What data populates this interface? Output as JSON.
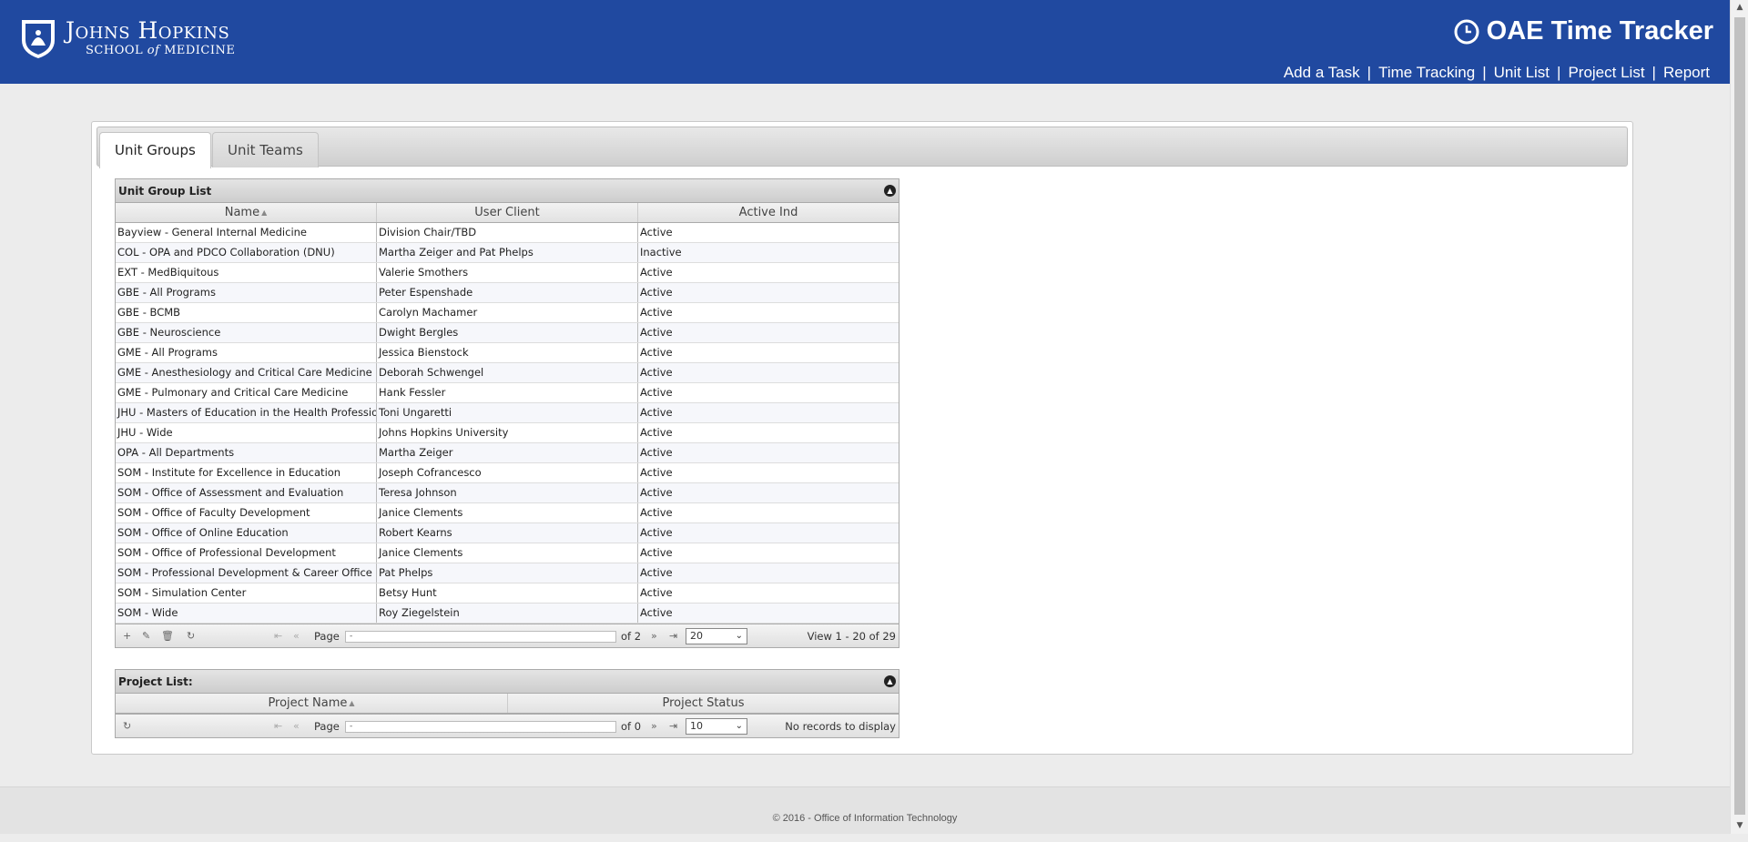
{
  "header": {
    "logo_line1": "Johns Hopkins",
    "logo_line2a": "SCHOOL",
    "logo_line2b": "of",
    "logo_line2c": "MEDICINE",
    "app_title": "OAE Time Tracker",
    "nav": [
      "Add a Task",
      "Time Tracking",
      "Unit List",
      "Project List",
      "Report"
    ],
    "nav_separator": "|"
  },
  "tabs": [
    {
      "label": "Unit Groups",
      "active": true
    },
    {
      "label": "Unit Teams",
      "active": false
    }
  ],
  "unit_group_grid": {
    "caption": "Unit Group List",
    "columns": [
      "Name",
      "User Client",
      "Active Ind"
    ],
    "rows": [
      [
        "Bayview - General Internal Medicine",
        "Division Chair/TBD",
        "Active"
      ],
      [
        "COL - OPA and PDCO Collaboration (DNU)",
        "Martha Zeiger and Pat Phelps",
        "Inactive"
      ],
      [
        "EXT - MedBiquitous",
        "Valerie Smothers",
        "Active"
      ],
      [
        "GBE - All Programs",
        "Peter Espenshade",
        "Active"
      ],
      [
        "GBE - BCMB",
        "Carolyn Machamer",
        "Active"
      ],
      [
        "GBE - Neuroscience",
        "Dwight Bergles",
        "Active"
      ],
      [
        "GME - All Programs",
        "Jessica Bienstock",
        "Active"
      ],
      [
        "GME - Anesthesiology and Critical Care Medicine (",
        "Deborah Schwengel",
        "Active"
      ],
      [
        "GME - Pulmonary and Critical Care Medicine",
        "Hank Fessler",
        "Active"
      ],
      [
        "JHU - Masters of Education in the Health Professio",
        "Toni Ungaretti",
        "Active"
      ],
      [
        "JHU - Wide",
        "Johns Hopkins University",
        "Active"
      ],
      [
        "OPA - All Departments",
        "Martha Zeiger",
        "Active"
      ],
      [
        "SOM - Institute for Excellence in Education",
        "Joseph Cofrancesco",
        "Active"
      ],
      [
        "SOM - Office of Assessment and Evaluation",
        "Teresa Johnson",
        "Active"
      ],
      [
        "SOM - Office of Faculty Development",
        "Janice Clements",
        "Active"
      ],
      [
        "SOM - Office of Online Education",
        "Robert Kearns",
        "Active"
      ],
      [
        "SOM - Office of Professional Development",
        "Janice Clements",
        "Active"
      ],
      [
        "SOM - Professional Development & Career Office",
        "Pat Phelps",
        "Active"
      ],
      [
        "SOM - Simulation Center",
        "Betsy Hunt",
        "Active"
      ],
      [
        "SOM - Wide",
        "Roy Ziegelstein",
        "Active"
      ]
    ],
    "pager": {
      "page_label": "Page",
      "page_value": "-",
      "of_text": "of 2",
      "rows_per_page": "20",
      "view_text": "View 1 - 20 of 29"
    }
  },
  "project_grid": {
    "caption": "Project List:",
    "columns": [
      "Project Name",
      "Project Status"
    ],
    "pager": {
      "page_label": "Page",
      "page_value": "-",
      "of_text": "of 0",
      "rows_per_page": "10",
      "view_text": "No records to display"
    }
  },
  "footer": {
    "text": "© 2016 - Office of Information Technology"
  },
  "colors": {
    "header_bg": "#2049a0",
    "page_bg": "#ececec"
  }
}
